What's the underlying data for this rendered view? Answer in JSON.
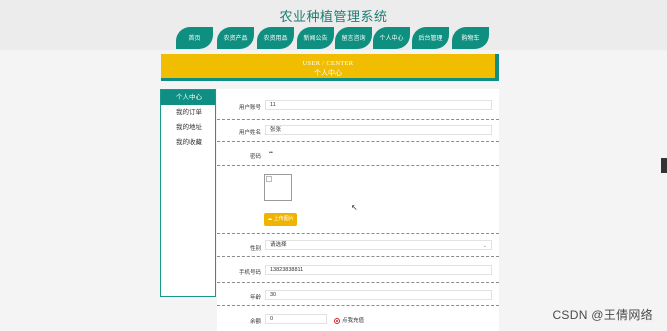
{
  "site": {
    "title": "农业种植管理系统"
  },
  "nav": {
    "items": [
      {
        "label": "首页"
      },
      {
        "label": "农资产品"
      },
      {
        "label": "农资用品"
      },
      {
        "label": "新闻公告"
      },
      {
        "label": "留言咨询"
      },
      {
        "label": "个人中心"
      },
      {
        "label": "后台管理"
      },
      {
        "label": "购物车"
      }
    ]
  },
  "banner": {
    "en": "USER / CENTER",
    "cn": "个人中心"
  },
  "sidebar": {
    "items": [
      {
        "label": "个人中心",
        "active": true
      },
      {
        "label": "我的订单"
      },
      {
        "label": "我的地址"
      },
      {
        "label": "我的收藏"
      }
    ]
  },
  "form": {
    "account": {
      "label": "用户账号",
      "value": "11"
    },
    "name": {
      "label": "用户姓名",
      "value": "张张"
    },
    "password": {
      "label": "密码",
      "value": "••"
    },
    "upload": {
      "label": "上传图片"
    },
    "gender": {
      "label": "性别",
      "value": "请选择"
    },
    "phone": {
      "label": "手机号码",
      "value": "13823838811"
    },
    "age": {
      "label": "年龄",
      "value": "30"
    },
    "balance": {
      "label": "余额",
      "value": "0",
      "action": "点我充值"
    }
  },
  "watermark": "CSDN @王倩网络",
  "colors": {
    "teal": "#0e8f80",
    "gold": "#f0bd00"
  }
}
